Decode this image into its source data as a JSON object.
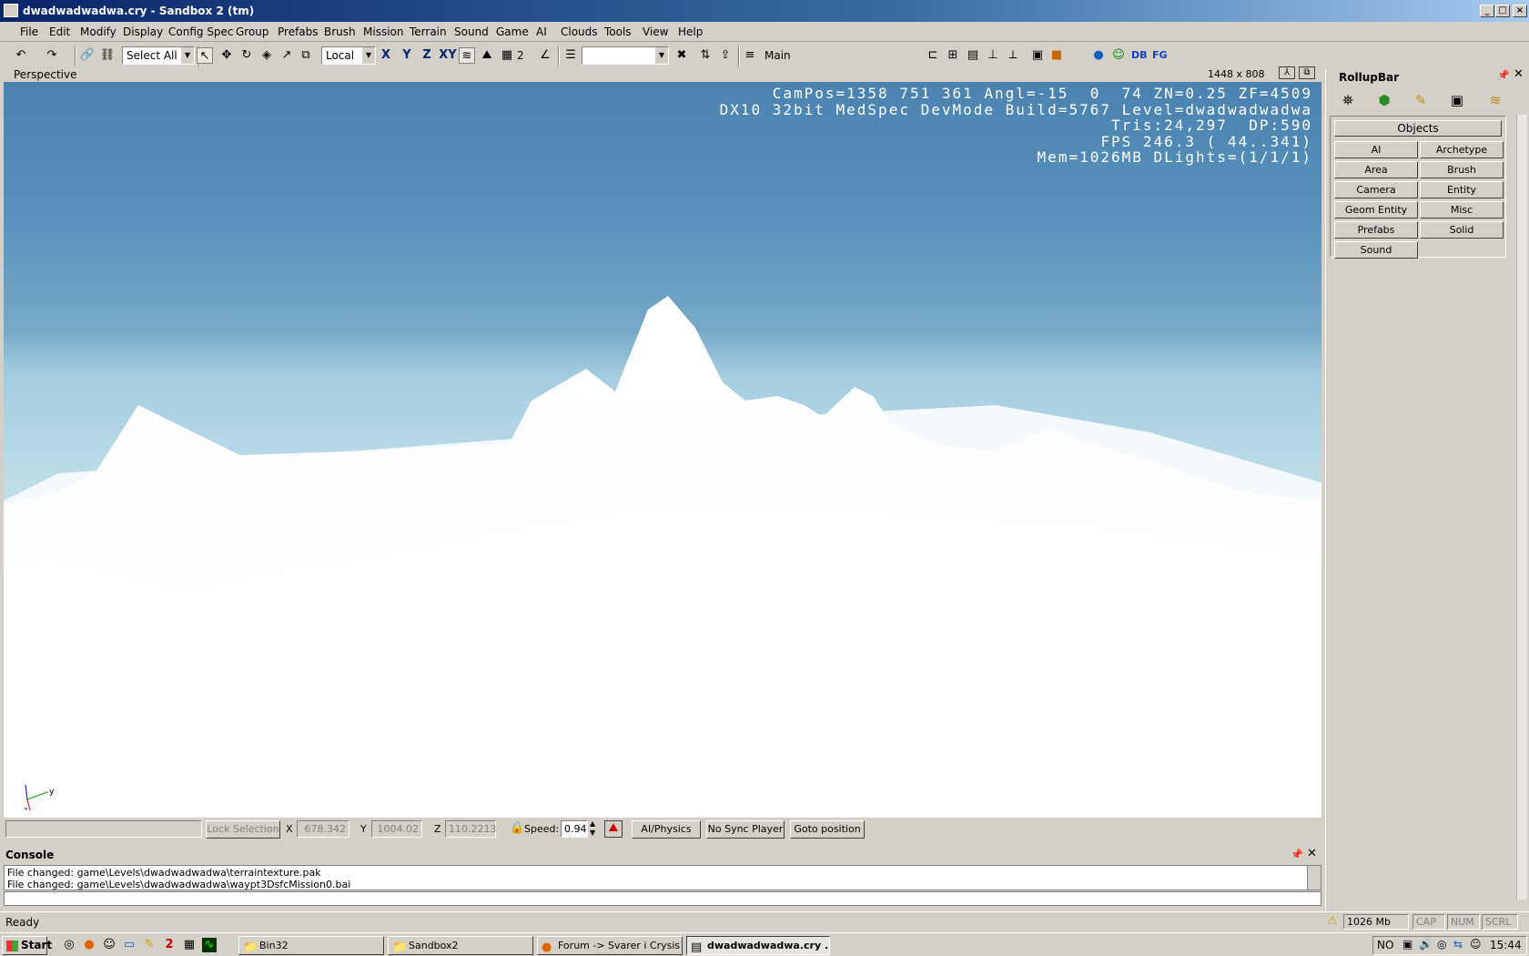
{
  "window": {
    "title": "dwadwadwadwa.cry - Sandbox 2 (tm)",
    "min_label": "_",
    "max_label": "□",
    "close_label": "×"
  },
  "menu": [
    "File",
    "Edit",
    "Modify",
    "Display",
    "Config Spec",
    "Group",
    "Prefabs",
    "Brush",
    "Mission",
    "Terrain",
    "Sound",
    "Game",
    "AI",
    "Clouds",
    "Tools",
    "View",
    "Help"
  ],
  "toolbar": {
    "select_filter": "Select All",
    "coord_system": "Local",
    "axis_x": "X",
    "axis_y": "Y",
    "axis_z": "Z",
    "axis_xy": "XY",
    "grid_value": "2",
    "layer": "Main",
    "db_label": "DB",
    "fg_label": "FG"
  },
  "viewport": {
    "name": "Perspective",
    "resolution": "1448 x 808",
    "hud": [
      "CamPos=1358 751 361 Angl=-15  0  74 ZN=0.25 ZF=4509",
      "DX10 32bit MedSpec DevMode Build=5767 Level=dwadwadwadwa",
      "Tris:24,297  DP:590",
      "FPS 246.3 ( 44..341)",
      "Mem=1026MB DLights=(1/1/1)"
    ],
    "axis_y": "y",
    "axis_z": "z"
  },
  "controls": {
    "lock_selection": "Lock Selection",
    "x_label": "X",
    "x_value": "678.342",
    "y_label": "Y",
    "y_value": "1004.02",
    "z_label": "Z",
    "z_value": "110.2213",
    "speed_label": "Speed:",
    "speed_value": "0.94",
    "ai_physics": "AI/Physics",
    "no_sync_player": "No Sync Player",
    "goto_position": "Goto position"
  },
  "console": {
    "title": "Console",
    "lines": [
      "File changed: game\\Levels\\dwadwadwadwa\\terraintexture.pak",
      "File changed: game\\Levels\\dwadwadwadwa\\waypt3DsfcMission0.bai"
    ]
  },
  "rollup": {
    "title": "RollupBar",
    "objects_header": "Objects",
    "buttons": [
      "AI",
      "Archetype Entity",
      "Area",
      "Brush",
      "Camera",
      "Entity",
      "Geom Entity",
      "Misc",
      "Prefabs",
      "Solid",
      "Sound"
    ]
  },
  "status": {
    "ready": "Ready",
    "memory": "1026 Mb",
    "cap": "CAP",
    "num": "NUM",
    "scrl": "SCRL"
  },
  "taskbar": {
    "start": "Start",
    "tasks": [
      "Bin32",
      "Sandbox2",
      "Forum -> Svarer i Crysis E...",
      "dwadwadwadwa.cry ..."
    ],
    "lang": "NO",
    "clock": "15:44"
  },
  "colors": {
    "sky_top": "#4b82b0",
    "terrain": "#ffffff",
    "chrome": "#d4d0c8"
  }
}
